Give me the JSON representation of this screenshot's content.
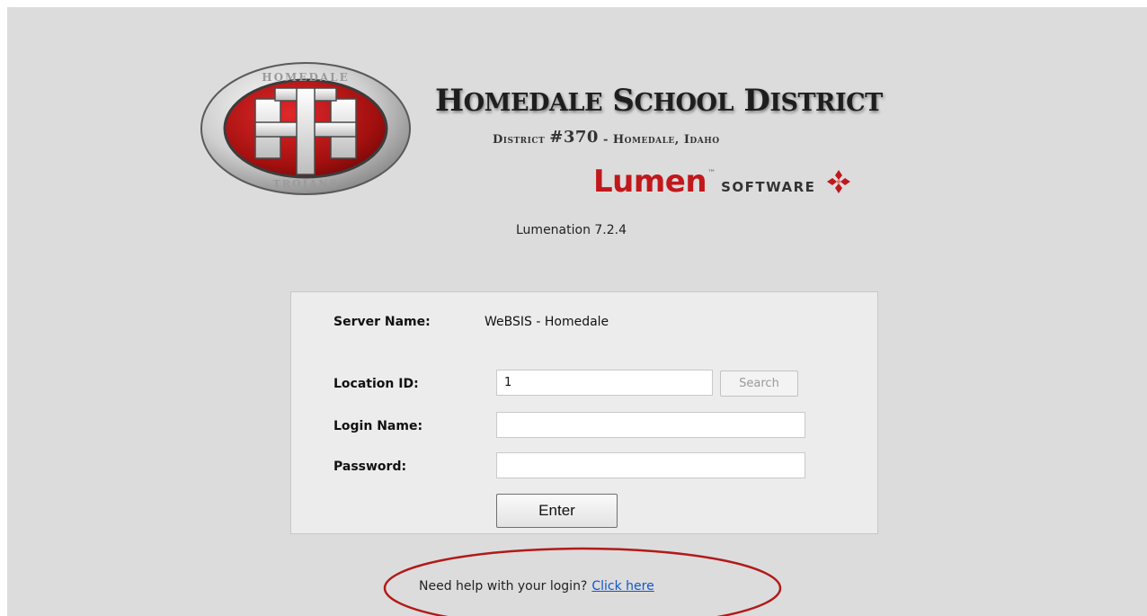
{
  "header": {
    "title_first_letter_1": "H",
    "title_rest_1": "OMEDALE",
    "title_first_letter_2": "S",
    "title_rest_2": "CHOOL",
    "title_first_letter_3": "D",
    "title_rest_3": "ISTRICT",
    "subtitle_prefix": "District ",
    "subtitle_number": "#370",
    "subtitle_suffix": " - Homedale, Idaho",
    "logo_top_text": "HOMEDALE",
    "logo_bottom_text": "TROJANS",
    "logo_letters": "HT"
  },
  "brand": {
    "name": "Lumen",
    "tm": "™",
    "suffix": "SOFTWARE"
  },
  "version": "Lumenation 7.2.4",
  "login": {
    "server_label": "Server Name:",
    "server_value": "WeBSIS - Homedale",
    "location_label": "Location ID:",
    "location_value": "1",
    "search_label": "Search",
    "login_label": "Login Name:",
    "login_value": "",
    "password_label": "Password:",
    "password_value": "",
    "enter_label": "Enter"
  },
  "help": {
    "text": "Need help with your login?",
    "link": "Click here"
  },
  "colors": {
    "brand_red": "#c0181c",
    "page_bg": "#dcdcdc",
    "link": "#1155cc",
    "annotation_oval": "#b21a1a"
  }
}
